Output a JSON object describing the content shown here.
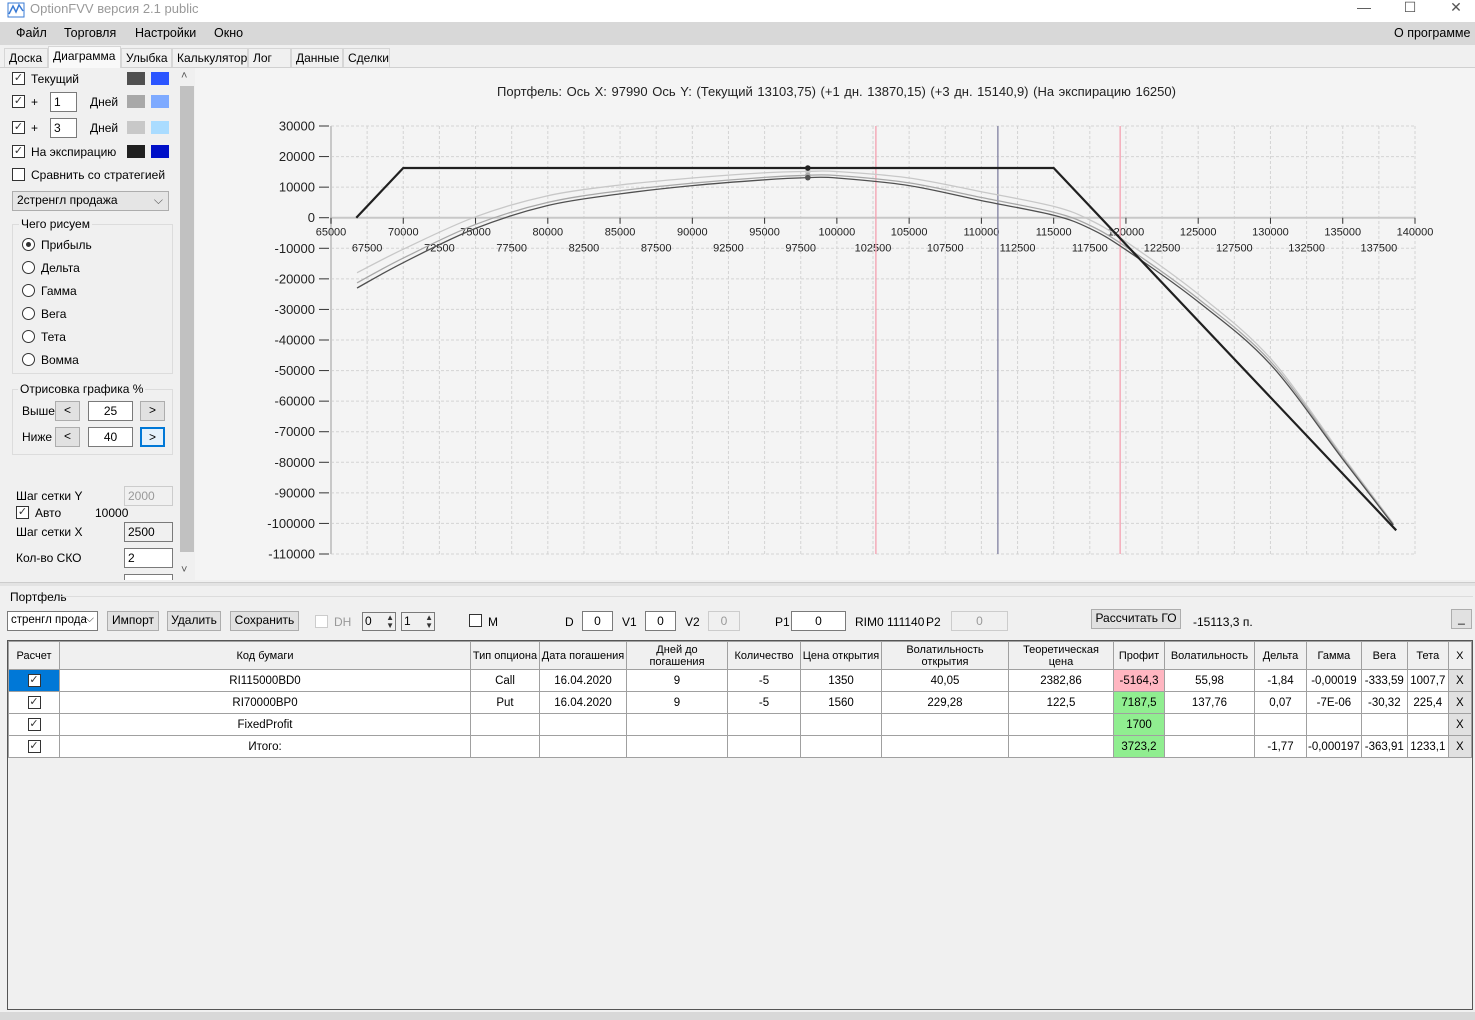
{
  "window": {
    "title": "OptionFVV версия 2.1 public",
    "minimize": "—",
    "maximize": "☐",
    "close": "✕"
  },
  "menu": {
    "items": [
      "Файл",
      "Торговля",
      "Настройки",
      "Окно"
    ],
    "about": "О программе"
  },
  "tabs": [
    "Доска",
    "Диаграмма",
    "Улыбка",
    "Калькулятор",
    "Лог",
    "Данные",
    "Сделки"
  ],
  "active_tab": "Диаграмма",
  "left_panel": {
    "series_rows": [
      {
        "label": "Текущий",
        "checked": true,
        "colors": [
          "#505050",
          "#2b55ff"
        ]
      },
      {
        "label": "+",
        "days": "1",
        "days_label": "Дней",
        "checked": true,
        "colors": [
          "#a8a8a8",
          "#7eaaff"
        ]
      },
      {
        "label": "+",
        "days": "3",
        "days_label": "Дней",
        "checked": true,
        "colors": [
          "#c8c8c8",
          "#aadcff"
        ]
      },
      {
        "label": "На экспирацию",
        "checked": true,
        "colors": [
          "#202020",
          "#0010c8"
        ]
      }
    ],
    "compare_label": "Сравнить со стратегией",
    "strategy_select": "2стренгл продажа",
    "draw_group": {
      "title": "Чего рисуем",
      "options": [
        "Прибыль",
        "Дельта",
        "Гамма",
        "Вега",
        "Тета",
        "Вомма"
      ],
      "selected": "Прибыль"
    },
    "range_group": {
      "title": "Отрисовка графика %",
      "above_label": "Выше",
      "above_value": "25",
      "below_label": "Ниже",
      "below_value": "40",
      "dec": "<",
      "inc": ">"
    },
    "grid_y_label": "Шаг сетки Y",
    "grid_y_value": "2000",
    "auto_label": "Авто",
    "auto_value": "10000",
    "auto_checked": true,
    "grid_x_label": "Шаг сетки X",
    "grid_x_value": "2500",
    "sko_label": "Кол-во СКО",
    "sko_value": "2",
    "scroll_up": "˄",
    "scroll_down": "˅"
  },
  "chart_title": "Портфель: Ось X: 97990 Ось Y:  (Текущий 13103,75)  (+1 дн. 13870,15)  (+3 дн. 15140,9)  (На экспирацию 16250)",
  "chart_data": {
    "type": "line",
    "xlim": [
      65000,
      140000
    ],
    "ylim": [
      -110000,
      30000
    ],
    "grid": true,
    "x_ticks_major": [
      "65000",
      "70000",
      "75000",
      "80000",
      "85000",
      "90000",
      "95000",
      "100000",
      "105000",
      "110000",
      "115000",
      "120000",
      "125000",
      "130000",
      "135000",
      "140000"
    ],
    "x_ticks_minor": [
      "67500",
      "72500",
      "77500",
      "82500",
      "87500",
      "92500",
      "97500",
      "102500",
      "107500",
      "112500",
      "117500",
      "122500",
      "127500",
      "132500",
      "137500"
    ],
    "y_ticks": [
      "30000",
      "20000",
      "10000",
      "0",
      "-10000",
      "-20000",
      "-30000",
      "-40000",
      "-50000",
      "-60000",
      "-70000",
      "-80000",
      "-90000",
      "-100000",
      "-110000"
    ],
    "cursor_x": 97990,
    "vertical_lines": [
      {
        "x": 102700,
        "color": "#f4a0b0"
      },
      {
        "x": 111140,
        "color": "#8080a0"
      },
      {
        "x": 119600,
        "color": "#f4a0b0"
      }
    ],
    "series": [
      {
        "key": "plus3",
        "color": "#c8c8c8",
        "x": [
          66800,
          70000,
          75000,
          80000,
          85000,
          90000,
          95000,
          97990,
          100000,
          105000,
          110000,
          115000,
          117500,
          120000,
          125000,
          130000,
          135000,
          138500
        ],
        "y": [
          -18000,
          -10300,
          300,
          7200,
          10700,
          13000,
          14700,
          15140.9,
          15100,
          13000,
          8500,
          3700,
          -700,
          -7800,
          -25000,
          -46000,
          -78000,
          -100000
        ]
      },
      {
        "key": "plus1",
        "color": "#a8a8a8",
        "x": [
          66800,
          70000,
          75000,
          80000,
          85000,
          90000,
          95000,
          97990,
          100000,
          105000,
          110000,
          115000,
          117500,
          120000,
          125000,
          130000,
          135000,
          138500
        ],
        "y": [
          -21300,
          -13200,
          -2200,
          5000,
          8800,
          11300,
          13200,
          13870.15,
          13800,
          11400,
          6600,
          1800,
          -2500,
          -9500,
          -26500,
          -47000,
          -78500,
          -100300
        ]
      },
      {
        "key": "current",
        "color": "#505050",
        "x": [
          66800,
          70000,
          75000,
          80000,
          85000,
          90000,
          95000,
          97990,
          100000,
          105000,
          110000,
          115000,
          117500,
          120000,
          125000,
          130000,
          135000,
          138500
        ],
        "y": [
          -23000,
          -14700,
          -3500,
          4000,
          7800,
          10500,
          12400,
          13103.75,
          13000,
          10500,
          5600,
          800,
          -3500,
          -10500,
          -27500,
          -48000,
          -79000,
          -100500
        ]
      },
      {
        "key": "expiration",
        "color": "#202020",
        "x": [
          66750,
          70000,
          115000,
          138700
        ],
        "y": [
          0,
          16250,
          16250,
          -102250
        ]
      }
    ]
  },
  "portfolio": {
    "title": "Портфель",
    "select": "стренгл прода",
    "import": "Импорт",
    "delete": "Удалить",
    "save": "Сохранить",
    "dh_label": "DH",
    "spin1": "0",
    "spin2": "1",
    "m_label": "M",
    "d_label": "D",
    "d_value": "0",
    "v1_label": "V1",
    "v1_value": "0",
    "v2_label": "V2",
    "v2_value": "0",
    "p1_label": "P1",
    "p1_value": "0",
    "instrument": "RIM0 111140",
    "p2_label": "P2",
    "p2_value": "0",
    "calc_go": "Рассчитать ГО",
    "go_value": "-15113,3 п.",
    "collapse": "_"
  },
  "table": {
    "headers": [
      "Расчет",
      "Код бумаги",
      "Тип опциона",
      "Дата погашения",
      "Дней до погашения",
      "Количество",
      "Цена открытия",
      "Волатильность открытия",
      "Теоретическая цена",
      "Профит",
      "Волатильность",
      "Дельта",
      "Гамма",
      "Вега",
      "Тета",
      "X"
    ],
    "rows": [
      {
        "checked": true,
        "code": "RI115000BD0",
        "type": "Call",
        "date": "16.04.2020",
        "days": "9",
        "qty": "-5",
        "price": "1350",
        "vol_open": "40,05",
        "theo": "2382,86",
        "profit": "-5164,3",
        "profit_sign": "neg",
        "vol": "55,98",
        "delta": "-1,84",
        "gamma": "-0,00019",
        "vega": "-333,59",
        "theta": "1007,7",
        "x": "X"
      },
      {
        "checked": true,
        "code": "RI70000BP0",
        "type": "Put",
        "date": "16.04.2020",
        "days": "9",
        "qty": "-5",
        "price": "1560",
        "vol_open": "229,28",
        "theo": "122,5",
        "profit": "7187,5",
        "profit_sign": "pos",
        "vol": "137,76",
        "delta": "0,07",
        "gamma": "-7E-06",
        "vega": "-30,32",
        "theta": "225,4",
        "x": "X"
      },
      {
        "checked": true,
        "code": "FixedProfit",
        "type": "",
        "date": "",
        "days": "",
        "qty": "",
        "price": "",
        "vol_open": "",
        "theo": "",
        "profit": "1700",
        "profit_sign": "pos",
        "vol": "",
        "delta": "",
        "gamma": "",
        "vega": "",
        "theta": "",
        "x": "X"
      },
      {
        "checked": true,
        "code": "Итого:",
        "type": "",
        "date": "",
        "days": "",
        "qty": "",
        "price": "",
        "vol_open": "",
        "theo": "",
        "profit": "3723,2",
        "profit_sign": "pos",
        "vol": "",
        "delta": "-1,77",
        "gamma": "-0,000197",
        "vega": "-363,91",
        "theta": "1233,1",
        "x": "X"
      }
    ]
  }
}
